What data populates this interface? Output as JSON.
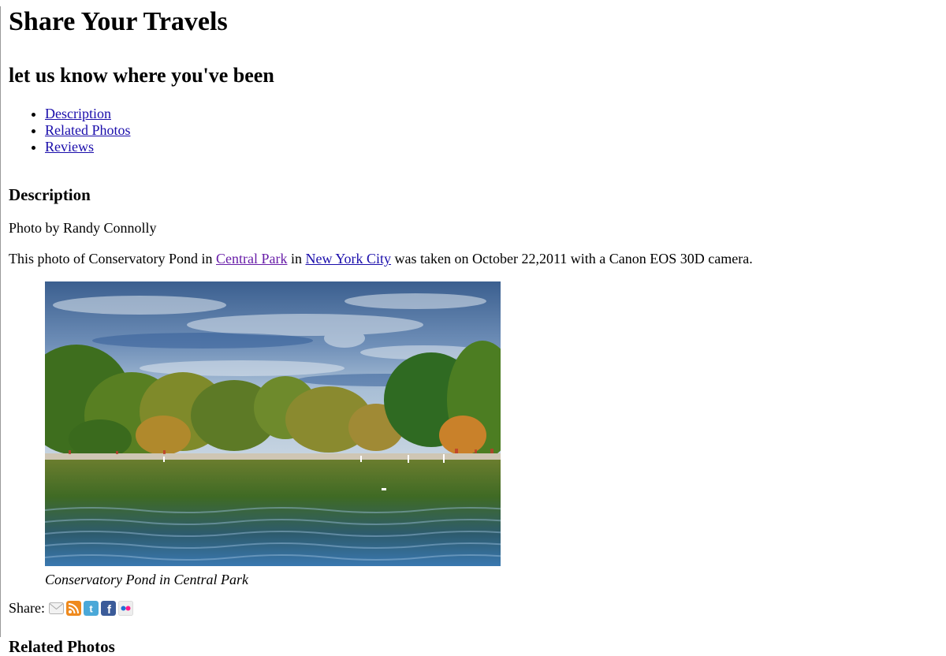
{
  "header": {
    "title": "Share Your Travels",
    "subtitle": "let us know where you've been"
  },
  "nav": {
    "items": [
      {
        "label": "Description"
      },
      {
        "label": "Related Photos"
      },
      {
        "label": "Reviews"
      }
    ]
  },
  "description": {
    "heading": "Description",
    "byline": "Photo by Randy Connolly",
    "text_1": "This photo of Conservatory Pond in ",
    "link_1": "Central Park",
    "text_2": " in ",
    "link_2": "New York City",
    "text_3": " was taken on October 22,2011 with a Canon EOS 30D camera."
  },
  "figure": {
    "caption": "Conservatory Pond in Central Park"
  },
  "share": {
    "label": "Share:",
    "icons": [
      "email-icon",
      "rss-icon",
      "twitter-icon",
      "facebook-icon",
      "flickr-icon"
    ]
  },
  "next_section": {
    "heading": "Related Photos"
  },
  "colors": {
    "link": "#1a0dab",
    "visited_link": "#681da8"
  }
}
